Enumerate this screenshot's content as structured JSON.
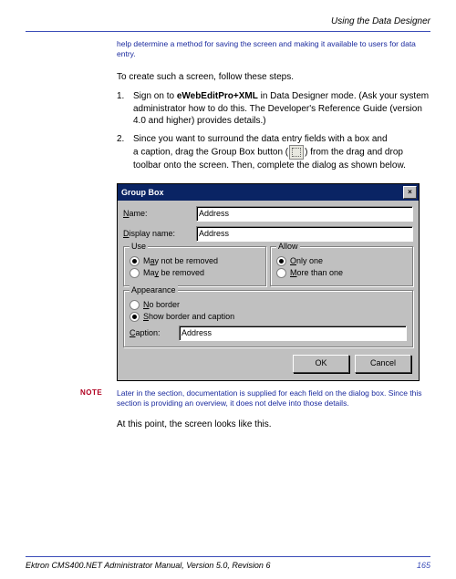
{
  "header": {
    "title": "Using the Data Designer"
  },
  "blue_top": "help determine a method for saving the screen and making it available to users for data entry.",
  "intro": "To create such a screen, follow these steps.",
  "steps": {
    "s1": {
      "num": "1.",
      "pre": "Sign on to ",
      "bold": "eWebEditPro+XML",
      "post": " in Data Designer mode. (Ask your system administrator how to do this. The Developer's Reference Guide (version 4.0 and higher) provides details.)"
    },
    "s2": {
      "num": "2.",
      "line1": "Since you want to surround the data entry fields with a box and",
      "line2a": "a caption, drag the Group Box button (",
      "line2b": ") from the drag and drop toolbar onto the screen. Then, complete the dialog as shown below."
    }
  },
  "dialog": {
    "title": "Group Box",
    "close": "×",
    "name_label": "Name:",
    "name_value": "Address",
    "display_label": "Display name:",
    "display_value": "Address",
    "use": {
      "title": "Use",
      "opt1_a": "M",
      "opt1_b": "ay not be removed",
      "opt2_a": "M",
      "opt2_b": "ay be removed"
    },
    "allow": {
      "title": "Allow",
      "opt1_a": "O",
      "opt1_b": "nly one",
      "opt2_a": "M",
      "opt2_b": "ore than one"
    },
    "appearance": {
      "title": "Appearance",
      "opt1_a": "N",
      "opt1_b": "o border",
      "opt2_a": "S",
      "opt2_b": "how border and caption",
      "caption_label_a": "C",
      "caption_label_b": "aption:",
      "caption_value": "Address"
    },
    "ok": "OK",
    "cancel": "Cancel"
  },
  "note": {
    "label": "NOTE",
    "text": "Later in the section, documentation is supplied for each field on the dialog box. Since this section is providing an overview, it does not delve into those details."
  },
  "after_note": "At this point, the screen looks like this.",
  "footer": {
    "left": "Ektron CMS400.NET Administrator Manual, Version 5.0, Revision 6",
    "page": "165"
  }
}
